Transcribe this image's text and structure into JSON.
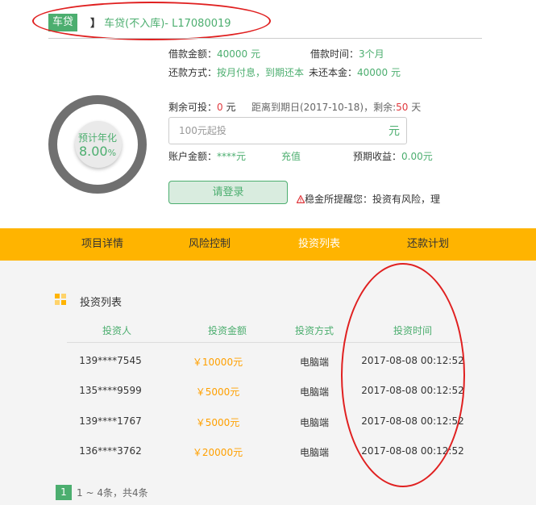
{
  "header": {
    "tag": "车贷",
    "bracket": "】",
    "title": "车贷(不入库)- L17080019"
  },
  "info": {
    "loan_amount_label": "借款金额：",
    "loan_amount_value": "40000 元",
    "loan_term_label": "借款时间：",
    "loan_term_value": "3个月",
    "repay_label": "还款方式：",
    "repay_value": "按月付息，到期还本",
    "remaining_principal_label": "未还本金：",
    "remaining_principal_value": "40000 元"
  },
  "rate": {
    "label": "预计年化",
    "value": "8.00",
    "unit": "%",
    "progress": 1.0
  },
  "invest": {
    "remaining_label": "剩余可投：",
    "remaining_value": "0",
    "remaining_unit": "元",
    "deadline_text": "距离到期日(2017-10-18)，剩余:",
    "days_left": "50",
    "days_unit": "天",
    "input_placeholder": "100元起投",
    "input_unit": "元",
    "account_label": "账户金额：",
    "account_value": "****元",
    "recharge": "充值",
    "expected_label": "预期收益：",
    "expected_value": "0.00元",
    "login_button": "请登录",
    "risk_text": "稳金所提醒您：投资有风险，理"
  },
  "nav": {
    "tabs": [
      "项目详情",
      "风险控制",
      "投资列表",
      "还款计划"
    ],
    "active": 2
  },
  "list": {
    "title": "投资列表",
    "columns": [
      "投资人",
      "投资金额",
      "投资方式",
      "投资时间"
    ],
    "rows": [
      {
        "investor": "139****7545",
        "amount": "￥10000元",
        "method": "电脑端",
        "time": "2017-08-08 00:12:52"
      },
      {
        "investor": "135****9599",
        "amount": "￥5000元",
        "method": "电脑端",
        "time": "2017-08-08 00:12:52"
      },
      {
        "investor": "139****1767",
        "amount": "￥5000元",
        "method": "电脑端",
        "time": "2017-08-08 00:12:52"
      },
      {
        "investor": "136****3762",
        "amount": "￥20000元",
        "method": "电脑端",
        "time": "2017-08-08 00:12:52"
      }
    ]
  },
  "pagination": {
    "current": "1",
    "summary": "1 ~ 4条，共4条"
  },
  "colors": {
    "green": "#4cae6f",
    "orange": "#ffb400",
    "red": "#e0393e",
    "annotation": "#e02020"
  }
}
